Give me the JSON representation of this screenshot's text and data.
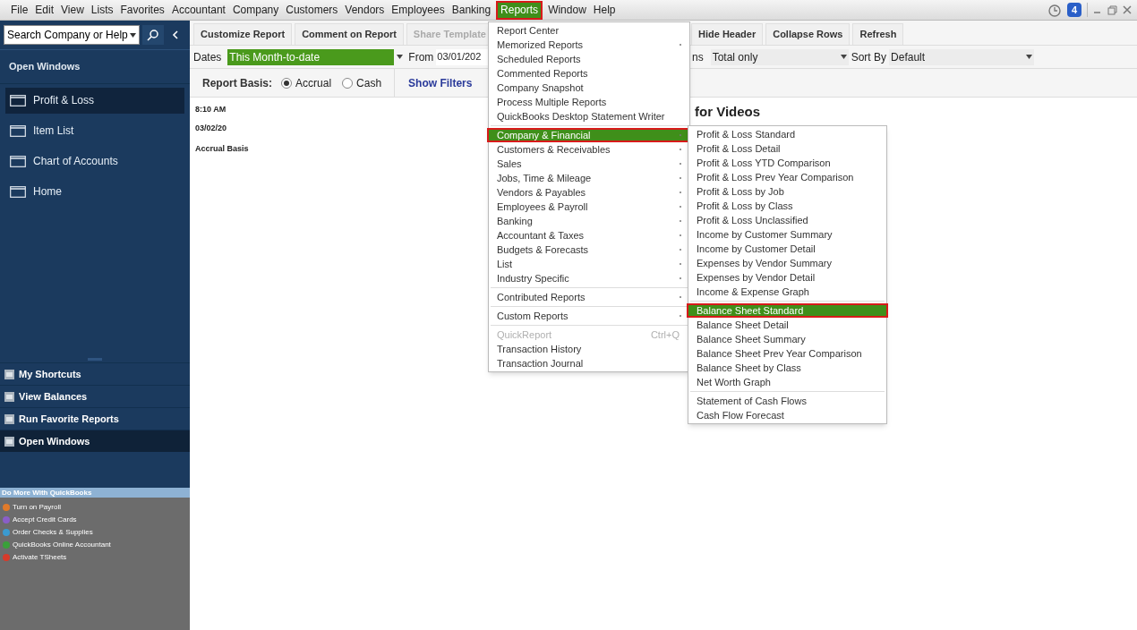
{
  "menu_bar": [
    {
      "label": "File",
      "selected": false
    },
    {
      "label": "Edit",
      "selected": false
    },
    {
      "label": "View",
      "selected": false
    },
    {
      "label": "Lists",
      "selected": false
    },
    {
      "label": "Favorites",
      "selected": false
    },
    {
      "label": "Accountant",
      "selected": false
    },
    {
      "label": "Company",
      "selected": false
    },
    {
      "label": "Customers",
      "selected": false
    },
    {
      "label": "Vendors",
      "selected": false
    },
    {
      "label": "Employees",
      "selected": false
    },
    {
      "label": "Banking",
      "selected": false
    },
    {
      "label": "Reports",
      "selected": true
    },
    {
      "label": "Window",
      "selected": false
    },
    {
      "label": "Help",
      "selected": false
    }
  ],
  "reminders_badge": "4",
  "sidebar": {
    "search": {
      "value": "Search Company or Help"
    },
    "open_windows_title": "Open Windows",
    "open_windows": [
      {
        "label": "Profit & Loss",
        "selected": true
      },
      {
        "label": "Item List",
        "selected": false
      },
      {
        "label": "Chart of Accounts",
        "selected": false
      },
      {
        "label": "Home",
        "selected": false
      }
    ],
    "sections": [
      {
        "label": "My Shortcuts",
        "selected": false
      },
      {
        "label": "View Balances",
        "selected": false
      },
      {
        "label": "Run Favorite Reports",
        "selected": false
      },
      {
        "label": "Open Windows",
        "selected": true
      }
    ],
    "promo_title": "Do More With QuickBooks",
    "promo_items": [
      {
        "label": "Turn on Payroll",
        "color": "#e07a2a"
      },
      {
        "label": "Accept Credit Cards",
        "color": "#8a5ec8"
      },
      {
        "label": "Order Checks & Supplies",
        "color": "#3a9ad0"
      },
      {
        "label": "QuickBooks Online Accountant",
        "color": "#3aa03a"
      },
      {
        "label": "Activate TSheets",
        "color": "#d83a2a"
      }
    ]
  },
  "report_toolbar": {
    "left_buttons": [
      {
        "label": "Customize Report",
        "disabled": false
      },
      {
        "label": "Comment on Report",
        "disabled": false
      },
      {
        "label": "Share Template",
        "disabled": true
      }
    ],
    "right_buttons": [
      {
        "label": "Hide Header",
        "disabled": false
      },
      {
        "label": "Collapse Rows",
        "disabled": false
      },
      {
        "label": "Refresh",
        "disabled": false
      }
    ]
  },
  "filters": {
    "dates_label": "Dates",
    "dates_value": "This Month-to-date",
    "from_label": "From",
    "from_value": "03/01/202",
    "columns_label_fragment": "ns",
    "columns_value": "Total only",
    "sort_label": "Sort By",
    "sort_value": "Default"
  },
  "report_basis": {
    "label": "Report Basis:",
    "options": [
      {
        "label": "Accrual",
        "selected": true
      },
      {
        "label": "Cash",
        "selected": false
      }
    ],
    "show_filters": "Show Filters"
  },
  "report": {
    "time": "8:10 AM",
    "date": "03/02/20",
    "basis": "Accrual Basis",
    "title_fragment": "for Videos"
  },
  "reports_menu": [
    {
      "kind": "item",
      "label": "Report Center",
      "submenu": false,
      "selected": false
    },
    {
      "kind": "item",
      "label": "Memorized Reports",
      "submenu": true,
      "selected": false
    },
    {
      "kind": "item",
      "label": "Scheduled Reports",
      "submenu": false,
      "selected": false
    },
    {
      "kind": "item",
      "label": "Commented Reports",
      "submenu": false,
      "selected": false
    },
    {
      "kind": "item",
      "label": "Company Snapshot",
      "submenu": false,
      "selected": false
    },
    {
      "kind": "item",
      "label": "Process Multiple Reports",
      "submenu": false,
      "selected": false
    },
    {
      "kind": "item",
      "label": "QuickBooks Desktop Statement Writer",
      "submenu": false,
      "selected": false
    },
    {
      "kind": "separator"
    },
    {
      "kind": "item",
      "label": "Company & Financial",
      "submenu": true,
      "selected": true
    },
    {
      "kind": "item",
      "label": "Customers & Receivables",
      "submenu": true,
      "selected": false
    },
    {
      "kind": "item",
      "label": "Sales",
      "submenu": true,
      "selected": false
    },
    {
      "kind": "item",
      "label": "Jobs, Time & Mileage",
      "submenu": true,
      "selected": false
    },
    {
      "kind": "item",
      "label": "Vendors & Payables",
      "submenu": true,
      "selected": false
    },
    {
      "kind": "item",
      "label": "Employees & Payroll",
      "submenu": true,
      "selected": false
    },
    {
      "kind": "item",
      "label": "Banking",
      "submenu": true,
      "selected": false
    },
    {
      "kind": "item",
      "label": "Accountant & Taxes",
      "submenu": true,
      "selected": false
    },
    {
      "kind": "item",
      "label": "Budgets & Forecasts",
      "submenu": true,
      "selected": false
    },
    {
      "kind": "item",
      "label": "List",
      "submenu": true,
      "selected": false
    },
    {
      "kind": "item",
      "label": "Industry Specific",
      "submenu": true,
      "selected": false
    },
    {
      "kind": "separator"
    },
    {
      "kind": "item",
      "label": "Contributed Reports",
      "submenu": true,
      "selected": false
    },
    {
      "kind": "separator"
    },
    {
      "kind": "item",
      "label": "Custom Reports",
      "submenu": true,
      "selected": false
    },
    {
      "kind": "separator"
    },
    {
      "kind": "disabled",
      "label": "QuickReport",
      "shortcut": "Ctrl+Q"
    },
    {
      "kind": "item",
      "label": "Transaction History",
      "submenu": false,
      "selected": false
    },
    {
      "kind": "item",
      "label": "Transaction Journal",
      "submenu": false,
      "selected": false
    }
  ],
  "company_financial_submenu": [
    {
      "kind": "item",
      "label": "Profit & Loss Standard",
      "selected": false
    },
    {
      "kind": "item",
      "label": "Profit & Loss Detail",
      "selected": false
    },
    {
      "kind": "item",
      "label": "Profit & Loss YTD Comparison",
      "selected": false
    },
    {
      "kind": "item",
      "label": "Profit & Loss Prev Year Comparison",
      "selected": false
    },
    {
      "kind": "item",
      "label": "Profit & Loss by Job",
      "selected": false
    },
    {
      "kind": "item",
      "label": "Profit & Loss by Class",
      "selected": false
    },
    {
      "kind": "item",
      "label": "Profit & Loss Unclassified",
      "selected": false
    },
    {
      "kind": "item",
      "label": "Income by Customer Summary",
      "selected": false
    },
    {
      "kind": "item",
      "label": "Income by Customer Detail",
      "selected": false
    },
    {
      "kind": "item",
      "label": "Expenses by Vendor Summary",
      "selected": false
    },
    {
      "kind": "item",
      "label": "Expenses by Vendor Detail",
      "selected": false
    },
    {
      "kind": "item",
      "label": "Income & Expense Graph",
      "selected": false
    },
    {
      "kind": "separator"
    },
    {
      "kind": "item",
      "label": "Balance Sheet Standard",
      "selected": true
    },
    {
      "kind": "item",
      "label": "Balance Sheet Detail",
      "selected": false
    },
    {
      "kind": "item",
      "label": "Balance Sheet Summary",
      "selected": false
    },
    {
      "kind": "item",
      "label": "Balance Sheet Prev Year Comparison",
      "selected": false
    },
    {
      "kind": "item",
      "label": "Balance Sheet by Class",
      "selected": false
    },
    {
      "kind": "item",
      "label": "Net Worth Graph",
      "selected": false
    },
    {
      "kind": "separator"
    },
    {
      "kind": "item",
      "label": "Statement of Cash Flows",
      "selected": false
    },
    {
      "kind": "item",
      "label": "Cash Flow Forecast",
      "selected": false
    }
  ]
}
